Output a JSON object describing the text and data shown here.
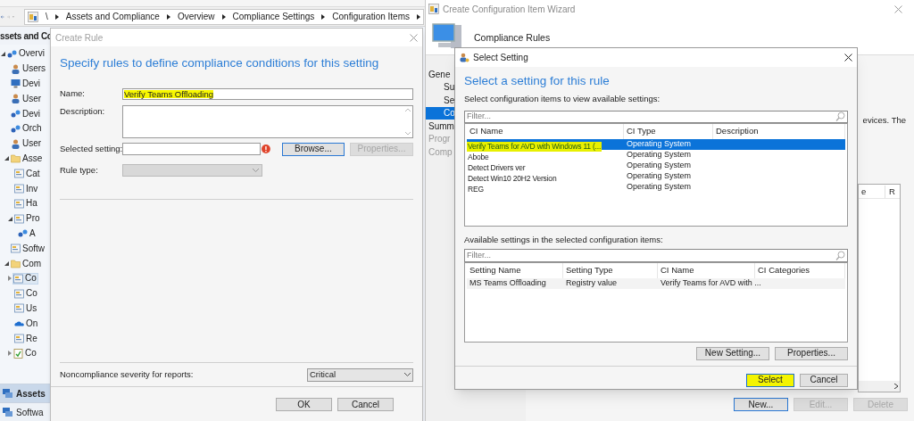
{
  "console": {
    "breadcrumb": [
      "\\",
      "Assets and Compliance",
      "Overview",
      "Compliance Settings",
      "Configuration Items"
    ],
    "sidebar_header": "ssets and Co",
    "tree": [
      {
        "label": "Overvi",
        "expanded": true,
        "kind": "network",
        "children": [
          {
            "label": "Users",
            "kind": "user"
          },
          {
            "label": "Devi",
            "kind": "monitor"
          },
          {
            "label": "User",
            "kind": "user"
          },
          {
            "label": "Devi",
            "kind": "network"
          },
          {
            "label": "Orch",
            "kind": "network"
          },
          {
            "label": "User",
            "kind": "user"
          },
          {
            "label": "Asse",
            "expanded": true,
            "kind": "folder",
            "children": [
              {
                "label": "Cat",
                "kind": "doc"
              },
              {
                "label": "Inv",
                "kind": "doc"
              },
              {
                "label": "Ha",
                "kind": "doc"
              },
              {
                "label": "Pro",
                "expanded": true,
                "kind": "doc",
                "children": [
                  {
                    "label": "A",
                    "kind": "network"
                  }
                ]
              }
            ]
          },
          {
            "label": "Softw",
            "kind": "doc"
          },
          {
            "label": "Com",
            "expanded": true,
            "kind": "folder",
            "children": [
              {
                "label": "Co",
                "expanded": false,
                "kind": "doc",
                "selected": true
              },
              {
                "label": "Co",
                "kind": "doc",
                "selected": false
              },
              {
                "label": "Us",
                "kind": "doc",
                "selected": false
              },
              {
                "label": "On",
                "kind": "cloud",
                "selected": false
              },
              {
                "label": "Re",
                "kind": "doc",
                "selected": false
              },
              {
                "label": "Co",
                "expanded": false,
                "kind": "check",
                "selected": false
              }
            ]
          }
        ]
      }
    ],
    "workspaces": [
      {
        "label": "Assets",
        "selected": true
      },
      {
        "label": "Softwa",
        "selected": false
      }
    ]
  },
  "create_rule": {
    "title": "Create Rule",
    "heading": "Specify rules to define compliance conditions for this setting",
    "name_label": "Name:",
    "name_value": "Verify Teams Offloading",
    "name_highlighted": true,
    "description_label": "Description:",
    "selected_setting_label": "Selected setting:",
    "error": true,
    "browse": "Browse...",
    "properties": {
      "label": "Properties...",
      "disabled": true
    },
    "rule_type_label": "Rule type:",
    "severity_label": "Noncompliance severity for reports:",
    "severity_value": "Critical",
    "buttons": [
      "OK",
      "Cancel"
    ]
  },
  "wizard": {
    "title": "Create Configuration Item Wizard",
    "header": "Compliance Rules",
    "nav": [
      {
        "label": "Gene",
        "indent": false,
        "selected": false,
        "disabled": false
      },
      {
        "label": "Su",
        "indent": true,
        "selected": false,
        "disabled": false
      },
      {
        "label": "Se",
        "indent": true,
        "selected": false,
        "disabled": false
      },
      {
        "label": "Co",
        "indent": true,
        "selected": true,
        "disabled": false
      },
      {
        "label": "Summ",
        "indent": false,
        "selected": false,
        "disabled": false
      },
      {
        "label": "Progr",
        "indent": false,
        "selected": false,
        "disabled": true
      },
      {
        "label": "Comp",
        "indent": false,
        "selected": false,
        "disabled": true
      }
    ],
    "text_fragment": "evices. The",
    "list_columns": [
      "e",
      "R"
    ],
    "buttons": [
      {
        "label": "New...",
        "disabled": false
      },
      {
        "label": "Edit...",
        "disabled": true
      },
      {
        "label": "Delete",
        "disabled": true
      }
    ]
  },
  "select_setting": {
    "title": "Select Setting",
    "heading": "Select a setting for this rule",
    "items_label": "Select configuration items to view available settings:",
    "filter_placeholder": "Filter...",
    "ci_columns": [
      "CI Name",
      "CI Type",
      "Description"
    ],
    "ci_rows": [
      {
        "name": "Verify Teams for AVD with Windows 11 (...",
        "type": "Operating System",
        "selected": true,
        "highlighted": true
      },
      {
        "name": "Abobe",
        "type": "Operating System",
        "selected": false,
        "highlighted": false
      },
      {
        "name": "Detect Drivers ver",
        "type": "Operating System",
        "selected": false,
        "highlighted": false
      },
      {
        "name": "Detect Win10 20H2 Version",
        "type": "Operating System",
        "selected": false,
        "highlighted": false
      },
      {
        "name": "REG",
        "type": "Operating System",
        "selected": false,
        "highlighted": false
      }
    ],
    "settings_label": "Available settings in the selected configuration items:",
    "settings_filter_placeholder": "Filter...",
    "setting_columns": [
      "Setting Name",
      "Setting Type",
      "CI Name",
      "CI Categories"
    ],
    "setting_rows": [
      {
        "name": "MS Teams Offloading",
        "type": "Registry value",
        "ci": "Verify Teams for AVD with ..."
      }
    ],
    "list_buttons": [
      "New Setting...",
      "Properties..."
    ],
    "select": {
      "label": "Select",
      "highlighted": true
    },
    "cancel": "Cancel"
  }
}
